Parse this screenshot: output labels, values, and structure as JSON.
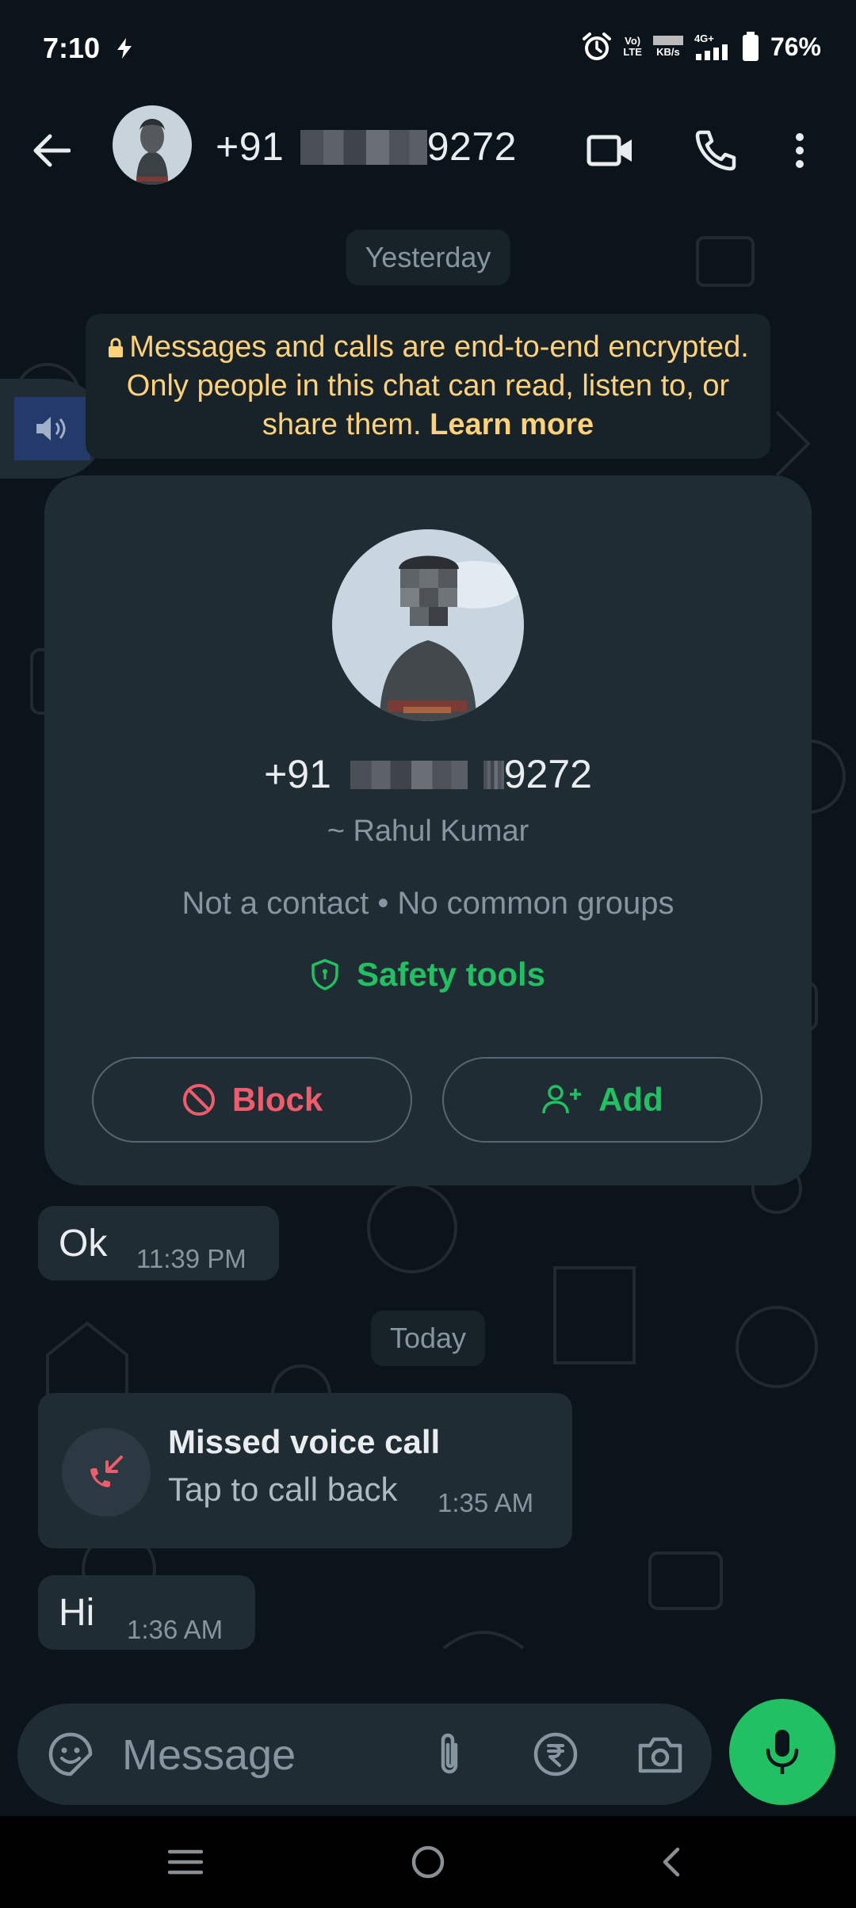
{
  "status_bar": {
    "time": "7:10",
    "volte": "Vo)",
    "lte": "LTE",
    "speed_unit": "KB/s",
    "network": "4G+",
    "battery": "76%"
  },
  "header": {
    "phone_prefix": "+91",
    "phone_suffix": "9272"
  },
  "chat": {
    "date_yesterday": "Yesterday",
    "encryption_text": "Messages and calls are end-to-end encrypted. Only people in this chat can read, listen to, or share them.",
    "learn_more": "Learn more",
    "card": {
      "phone_prefix": "+91",
      "phone_suffix": "9272",
      "name": "~ Rahul Kumar",
      "meta": "Not a contact • No common groups",
      "safety_tools": "Safety tools",
      "block_label": "Block",
      "add_label": "Add"
    },
    "messages": [
      {
        "text": "Ok",
        "time": "11:39 PM"
      },
      {
        "text": "Hi",
        "time": "1:36 AM"
      }
    ],
    "date_today": "Today",
    "missed_call": {
      "title": "Missed voice call",
      "subtitle": "Tap to call back",
      "time": "1:35 AM"
    }
  },
  "input": {
    "placeholder": "Message"
  },
  "colors": {
    "accent_green": "#21c063",
    "danger_red": "#f15c6d",
    "notice_yellow": "#ffd279",
    "background": "#0b141a",
    "bubble": "#202c33"
  }
}
